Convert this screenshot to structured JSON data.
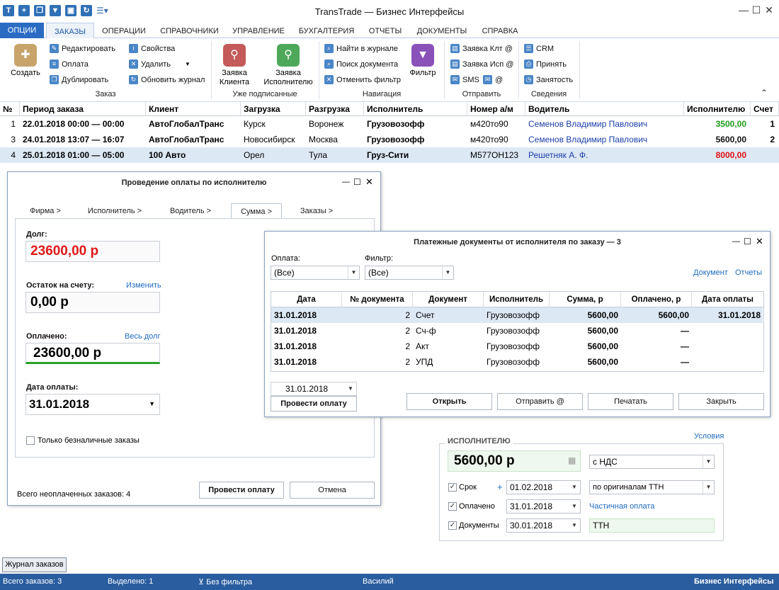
{
  "app_title": "TransTrade — Бизнес Интерфейсы",
  "window_controls": {
    "minimize": "—",
    "maximize": "☐",
    "close": "✕"
  },
  "menu": {
    "options": "ОПЦИИ",
    "items": [
      "ЗАКАЗЫ",
      "ОПЕРАЦИИ",
      "СПРАВОЧНИКИ",
      "УПРАВЛЕНИЕ",
      "БУХГАЛТЕРИЯ",
      "ОТЧЕТЫ",
      "ДОКУМЕНТЫ",
      "СПРАВКА"
    ]
  },
  "ribbon": {
    "create": "Создать",
    "edit": "Редактировать",
    "payment": "Оплата",
    "duplicate": "Дублировать",
    "properties": "Свойства",
    "delete": "Удалить",
    "refresh_journal": "Обновить журнал",
    "group_order": "Заказ",
    "client_request_1": "Заявка",
    "client_request_2": "Клиента",
    "exec_request_1": "Заявка",
    "exec_request_2": "Исполнителю",
    "group_signed": "Уже подписанные",
    "find_in_journal": "Найти в журнале",
    "find_document": "Поиск документа",
    "cancel_filter": "Отменить фильтр",
    "filter": "Фильтр",
    "group_navigation": "Навигация",
    "client_req_email": "Заявка Клт @",
    "exec_req_email": "Заявка Исп @",
    "sms": "SMS",
    "at": "@",
    "group_send": "Отправить",
    "crm": "CRM",
    "accept": "Принять",
    "busy": "Занятость",
    "group_info": "Сведения"
  },
  "grid": {
    "headers": [
      "№",
      "Период заказа",
      "Клиент",
      "Загрузка",
      "Разгрузка",
      "Исполнитель",
      "Номер а/м",
      "Водитель",
      "Исполнителю",
      "Счет"
    ],
    "rows": [
      {
        "num": "1",
        "period": "22.01.2018 00:00 — 00:00",
        "client": "АвтоГлобалТранс",
        "load": "Курск",
        "unload": "Воронеж",
        "executor": "Грузовозофф",
        "car": "м420то90",
        "driver": "Семенов Владимир Павлович",
        "amount": "3500,00",
        "invoice": "1",
        "amount_color": "#1a9c1a"
      },
      {
        "num": "3",
        "period": "24.01.2018 13:07 — 16:07",
        "client": "АвтоГлобалТранс",
        "load": "Новосибирск",
        "unload": "Москва",
        "executor": "Грузовозофф",
        "car": "м420то90",
        "driver": "Семенов Владимир Павлович",
        "amount": "5600,00",
        "invoice": "2",
        "amount_color": "#111111"
      },
      {
        "num": "4",
        "period": "25.01.2018 01:00 — 05:00",
        "client": "100 Авто",
        "load": "Орел",
        "unload": "Тула",
        "executor": "Груз-Сити",
        "car": "М577ОН123",
        "driver": "Решетняк А. Ф.",
        "amount": "8000,00",
        "invoice": "",
        "amount_color": "#e01010"
      }
    ]
  },
  "payment_dialog": {
    "title": "Проведение оплаты по исполнителю",
    "tabs": [
      "Фирма >",
      "Исполнитель >",
      "Водитель >",
      "Сумма >",
      "Заказы >"
    ],
    "debt_label": "Долг:",
    "debt_value": "23600,00 р",
    "balance_label": "Остаток на счету:",
    "balance_link": "Изменить",
    "balance_value": "0,00 р",
    "paid_label": "Оплачено:",
    "paid_link": "Весь долг",
    "paid_value": "23600,00 р",
    "date_label": "Дата оплаты:",
    "date_value": "31.01.2018",
    "cashless_only": "Только безналичные заказы",
    "unpaid_total": "Всего неоплаченных заказов:  4",
    "submit": "Провести оплату",
    "cancel": "Отмена"
  },
  "docs_dialog": {
    "title": "Платежные документы от исполнителя по заказу — 3",
    "payment_label": "Оплата:",
    "payment_value": "(Все)",
    "filter_label": "Фильтр:",
    "filter_value": "(Все)",
    "link_document": "Документ",
    "link_reports": "Отчеты",
    "headers": [
      "Дата",
      "№ документа",
      "Документ",
      "Исполнитель",
      "Сумма, р",
      "Оплачено, р",
      "Дата оплаты"
    ],
    "rows": [
      {
        "date": "31.01.2018",
        "num": "2",
        "doc": "Счет",
        "executor": "Грузовозофф",
        "sum": "5600,00",
        "paid": "5600,00",
        "paid_date": "31.01.2018"
      },
      {
        "date": "31.01.2018",
        "num": "2",
        "doc": "Сч-ф",
        "executor": "Грузовозофф",
        "sum": "5600,00",
        "paid": "—",
        "paid_date": ""
      },
      {
        "date": "31.01.2018",
        "num": "2",
        "doc": "Акт",
        "executor": "Грузовозофф",
        "sum": "5600,00",
        "paid": "—",
        "paid_date": ""
      },
      {
        "date": "31.01.2018",
        "num": "2",
        "doc": "УПД",
        "executor": "Грузовозофф",
        "sum": "5600,00",
        "paid": "—",
        "paid_date": ""
      }
    ],
    "date_value": "31.01.2018",
    "submit": "Провести оплату",
    "open": "Открыть",
    "send": "Отправить @",
    "print": "Печатать",
    "close": "Закрыть"
  },
  "executor_panel": {
    "legend": "ИСПОЛНИТЕЛЮ",
    "conditions_link": "Условия",
    "amount": "5600,00 р",
    "vat": "с НДС",
    "term_label": "Срок",
    "plus": "+",
    "term_date": "01.02.2018",
    "term_basis": "по оригиналам ТТН",
    "paid_label": "Оплачено",
    "paid_date": "31.01.2018",
    "partial_link": "Частичная оплата",
    "docs_label": "Документы",
    "docs_date": "30.01.2018",
    "docs_value": "ТТН"
  },
  "journal_tab": "Журнал заказов",
  "status": {
    "total": "Всего заказов:  3",
    "selected": "Выделено:  1",
    "filter": "Без фильтра",
    "user": "Василий",
    "brand": "Бизнес Интерфейсы"
  }
}
